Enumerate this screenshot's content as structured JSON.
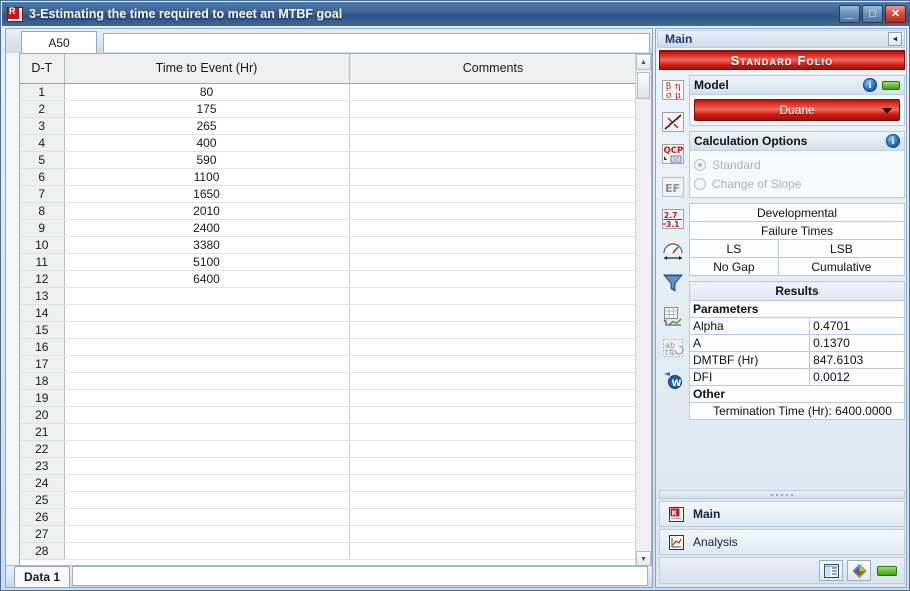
{
  "window": {
    "title": "3-Estimating the time required to meet an MTBF goal",
    "icon": "reliasoft-document-icon",
    "controls": {
      "minimize": "_",
      "maximize": "□",
      "close": "✕"
    }
  },
  "spreadsheet": {
    "cell_reference": "A50",
    "formula_value": "",
    "columns": [
      "D-T",
      "Time to Event (Hr)",
      "Comments"
    ],
    "rows": [
      {
        "n": "1",
        "time": "80",
        "comments": ""
      },
      {
        "n": "2",
        "time": "175",
        "comments": ""
      },
      {
        "n": "3",
        "time": "265",
        "comments": ""
      },
      {
        "n": "4",
        "time": "400",
        "comments": ""
      },
      {
        "n": "5",
        "time": "590",
        "comments": ""
      },
      {
        "n": "6",
        "time": "1100",
        "comments": ""
      },
      {
        "n": "7",
        "time": "1650",
        "comments": ""
      },
      {
        "n": "8",
        "time": "2010",
        "comments": ""
      },
      {
        "n": "9",
        "time": "2400",
        "comments": ""
      },
      {
        "n": "10",
        "time": "3380",
        "comments": ""
      },
      {
        "n": "11",
        "time": "5100",
        "comments": ""
      },
      {
        "n": "12",
        "time": "6400",
        "comments": ""
      },
      {
        "n": "13",
        "time": "",
        "comments": ""
      },
      {
        "n": "14",
        "time": "",
        "comments": ""
      },
      {
        "n": "15",
        "time": "",
        "comments": ""
      },
      {
        "n": "16",
        "time": "",
        "comments": ""
      },
      {
        "n": "17",
        "time": "",
        "comments": ""
      },
      {
        "n": "18",
        "time": "",
        "comments": ""
      },
      {
        "n": "19",
        "time": "",
        "comments": ""
      },
      {
        "n": "20",
        "time": "",
        "comments": ""
      },
      {
        "n": "21",
        "time": "",
        "comments": ""
      },
      {
        "n": "22",
        "time": "",
        "comments": ""
      },
      {
        "n": "23",
        "time": "",
        "comments": ""
      },
      {
        "n": "24",
        "time": "",
        "comments": ""
      },
      {
        "n": "25",
        "time": "",
        "comments": ""
      },
      {
        "n": "26",
        "time": "",
        "comments": ""
      },
      {
        "n": "27",
        "time": "",
        "comments": ""
      },
      {
        "n": "28",
        "time": "",
        "comments": ""
      }
    ],
    "sheet_tab": "Data 1",
    "scrollbar": {
      "up_arrow": "▲",
      "down_arrow": "▼"
    }
  },
  "panel": {
    "header": "Main",
    "collapse_arrow": "◄",
    "banner": "Standard Folio",
    "rail_icons": [
      "distribution-parameters-icon",
      "plot-fit-line-icon",
      "qcp-quick-calculation-pad-icon",
      "ef-event-failure-icon",
      "rounding-precision-icon",
      "gauge-target-icon",
      "filter-funnel-icon",
      "grid-to-plot-icon",
      "alt-text-swap-icon",
      "watermark-w-icon"
    ],
    "model_group": {
      "title": "Model",
      "info_icon": "info-icon",
      "indicator": "green-status-pill",
      "selected": "Duane"
    },
    "calculation_options": {
      "title": "Calculation Options",
      "info_icon": "info-icon",
      "options": [
        {
          "label": "Standard",
          "selected": true
        },
        {
          "label": "Change of Slope",
          "selected": false
        }
      ]
    },
    "settings": {
      "data_type": "Developmental",
      "event_type": "Failure Times",
      "analysis_method": "LS",
      "ranking_method": "LSB",
      "gap_setting": "No Gap",
      "time_setting": "Cumulative"
    },
    "results": {
      "title": "Results",
      "parameters_label": "Parameters",
      "parameters": [
        {
          "name": "Alpha",
          "value": "0.4701"
        },
        {
          "name": "A",
          "value": "0.1370"
        },
        {
          "name": "DMTBF (Hr)",
          "value": "847.6103"
        },
        {
          "name": "DFI",
          "value": "0.0012"
        }
      ],
      "other_label": "Other",
      "other_value": "Termination Time (Hr): 6400.0000"
    },
    "nav": [
      {
        "label": "Main",
        "icon": "reliasoft-document-icon"
      },
      {
        "label": "Analysis",
        "icon": "analysis-plot-icon"
      }
    ],
    "footer_buttons": [
      "report-sheet-icon",
      "plot-diamond-icon",
      "green-status-pill"
    ]
  },
  "colors": {
    "accent_red": "#cf1d14",
    "title_blue": "#3f679a",
    "info_blue": "#1461b8",
    "status_green": "#3f9b1e",
    "text_red": "#e8130a",
    "text_blue": "#1030e0"
  }
}
